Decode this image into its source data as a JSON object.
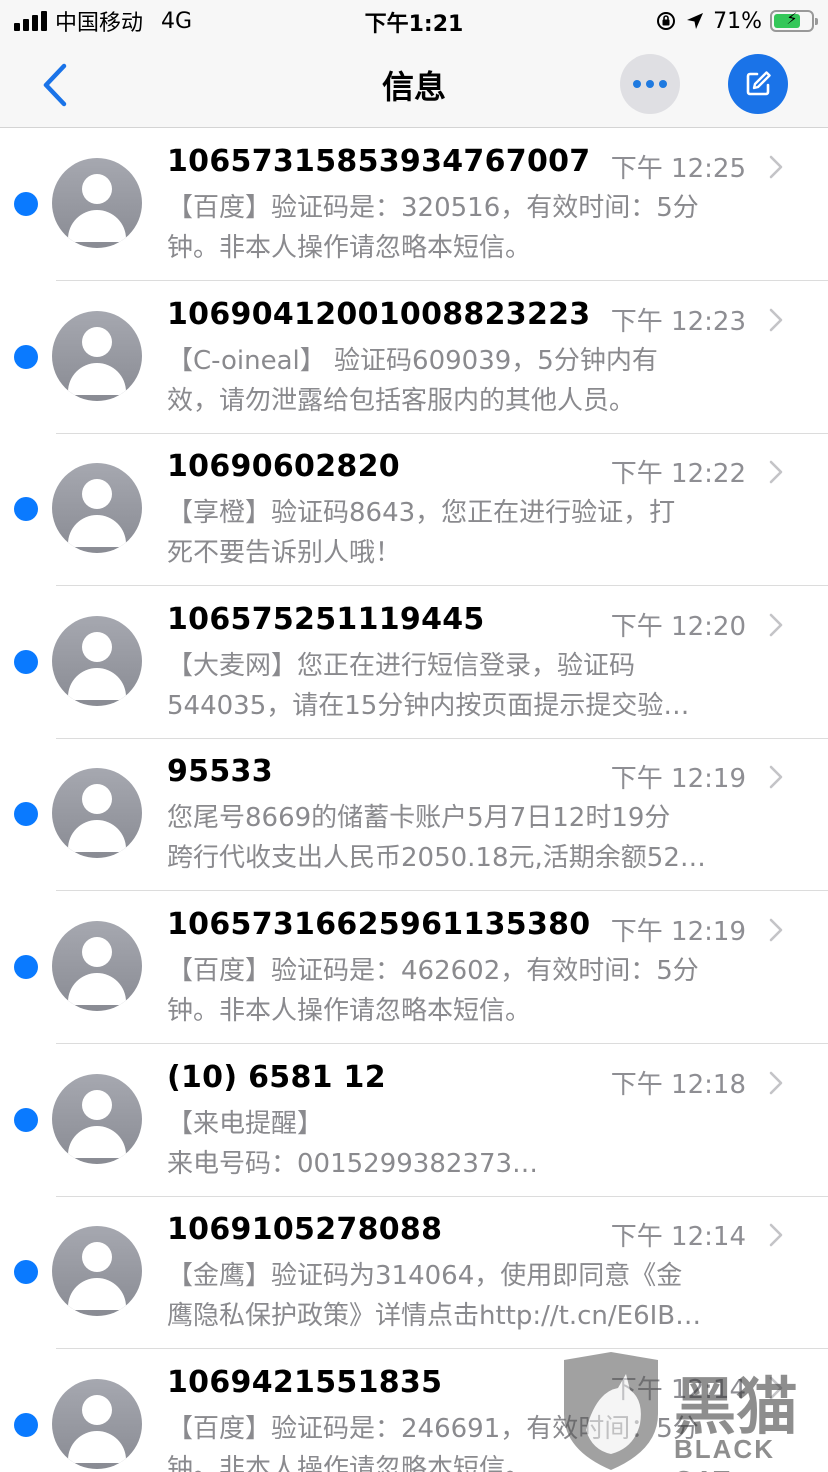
{
  "status_bar": {
    "carrier": "中国移动",
    "network": "4G",
    "time": "下午1:21",
    "battery_percent": "71%",
    "battery_level": 0.71,
    "battery_color": "#34c759"
  },
  "nav": {
    "title": "信息",
    "back_icon": "chevron-left-icon",
    "more_icon": "ellipsis-icon",
    "compose_icon": "compose-icon",
    "accent": "#1a73e8"
  },
  "messages": [
    {
      "sender": "10657315853934767007",
      "time": "下午 12:25",
      "unread": true,
      "preview": [
        "【百度】验证码是：320516，有效时间：5分",
        "钟。非本人操作请忽略本短信。"
      ]
    },
    {
      "sender": "10690412001008823223",
      "time": "下午 12:23",
      "unread": true,
      "preview": [
        "【C-oineal】 验证码609039，5分钟内有",
        "效，请勿泄露给包括客服内的其他人员。"
      ]
    },
    {
      "sender": "10690602820",
      "time": "下午 12:22",
      "unread": true,
      "preview": [
        "【享橙】验证码8643，您正在进行验证，打",
        "死不要告诉别人哦！"
      ]
    },
    {
      "sender": "106575251119445",
      "time": "下午 12:20",
      "unread": true,
      "preview": [
        "【大麦网】您正在进行短信登录，验证码",
        "544035，请在15分钟内按页面提示提交验…"
      ]
    },
    {
      "sender": "95533",
      "time": "下午 12:19",
      "unread": true,
      "preview": [
        "您尾号8669的储蓄卡账户5月7日12时19分",
        "跨行代收支出人民币2050.18元,活期余额52…"
      ]
    },
    {
      "sender": "10657316625961135380",
      "time": "下午 12:19",
      "unread": true,
      "preview": [
        "【百度】验证码是：462602，有效时间：5分",
        "钟。非本人操作请忽略本短信。"
      ]
    },
    {
      "sender": "(10) 6581 12",
      "time": "下午 12:18",
      "unread": true,
      "preview": [
        "【来电提醒】",
        "来电号码：0015299382373…"
      ]
    },
    {
      "sender": "1069105278088",
      "time": "下午 12:14",
      "unread": true,
      "preview": [
        "【金鹰】验证码为314064，使用即同意《金",
        "鹰隐私保护政策》详情点击http://t.cn/E6IB…"
      ]
    },
    {
      "sender": "1069421551835",
      "time": "下午 12:14",
      "unread": true,
      "preview": [
        "【百度】验证码是：246691，有效时间：5分",
        "钟。非本人操作请忽略本短信。"
      ]
    }
  ],
  "unread_color": "#0a7aff",
  "watermark": {
    "logo_text": "黑猫",
    "sub_text": "BLACK CAT"
  }
}
